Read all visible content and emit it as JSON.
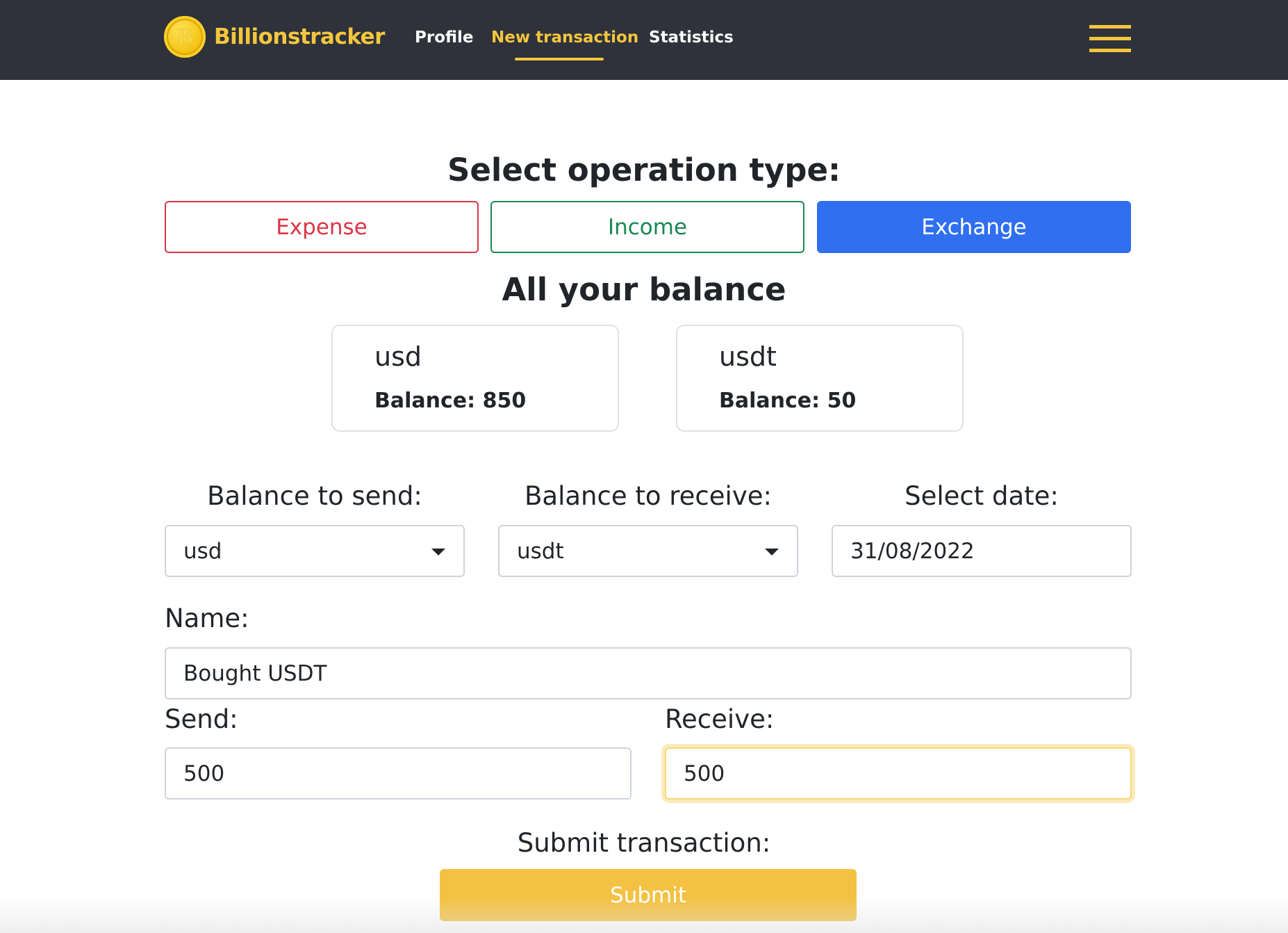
{
  "navbar": {
    "logo_letter": "B",
    "brand": "Billionstracker",
    "links": [
      {
        "label": "Profile",
        "active": false
      },
      {
        "label": "New transaction",
        "active": true
      },
      {
        "label": "Statistics",
        "active": false
      }
    ],
    "menu_icon": "hamburger-menu-icon",
    "accent_color": "#f4c63d",
    "background_color": "#2f323a"
  },
  "operation": {
    "heading": "Select operation type:",
    "buttons": [
      {
        "label": "Expense",
        "selected": false,
        "color": "#dc3545"
      },
      {
        "label": "Income",
        "selected": false,
        "color": "#198754"
      },
      {
        "label": "Exchange",
        "selected": true,
        "color": "#2f6ff0"
      }
    ]
  },
  "balances": {
    "heading": "All your balance",
    "cards": [
      {
        "currency": "usd",
        "balance": "Balance: 850"
      },
      {
        "currency": "usdt",
        "balance": "Balance: 50"
      }
    ]
  },
  "form": {
    "send_balance": {
      "label": "Balance to send:",
      "value": "usd"
    },
    "receive_balance": {
      "label": "Balance to receive:",
      "value": "usdt"
    },
    "date": {
      "label": "Select date:",
      "value": "31/08/2022"
    },
    "name": {
      "label": "Name:",
      "value": "Bought USDT"
    },
    "send": {
      "label": "Send:",
      "value": "500"
    },
    "receive": {
      "label": "Receive:",
      "value": "500"
    },
    "submit": {
      "label": "Submit transaction:",
      "button": "Submit",
      "color": "#f4c242"
    }
  }
}
